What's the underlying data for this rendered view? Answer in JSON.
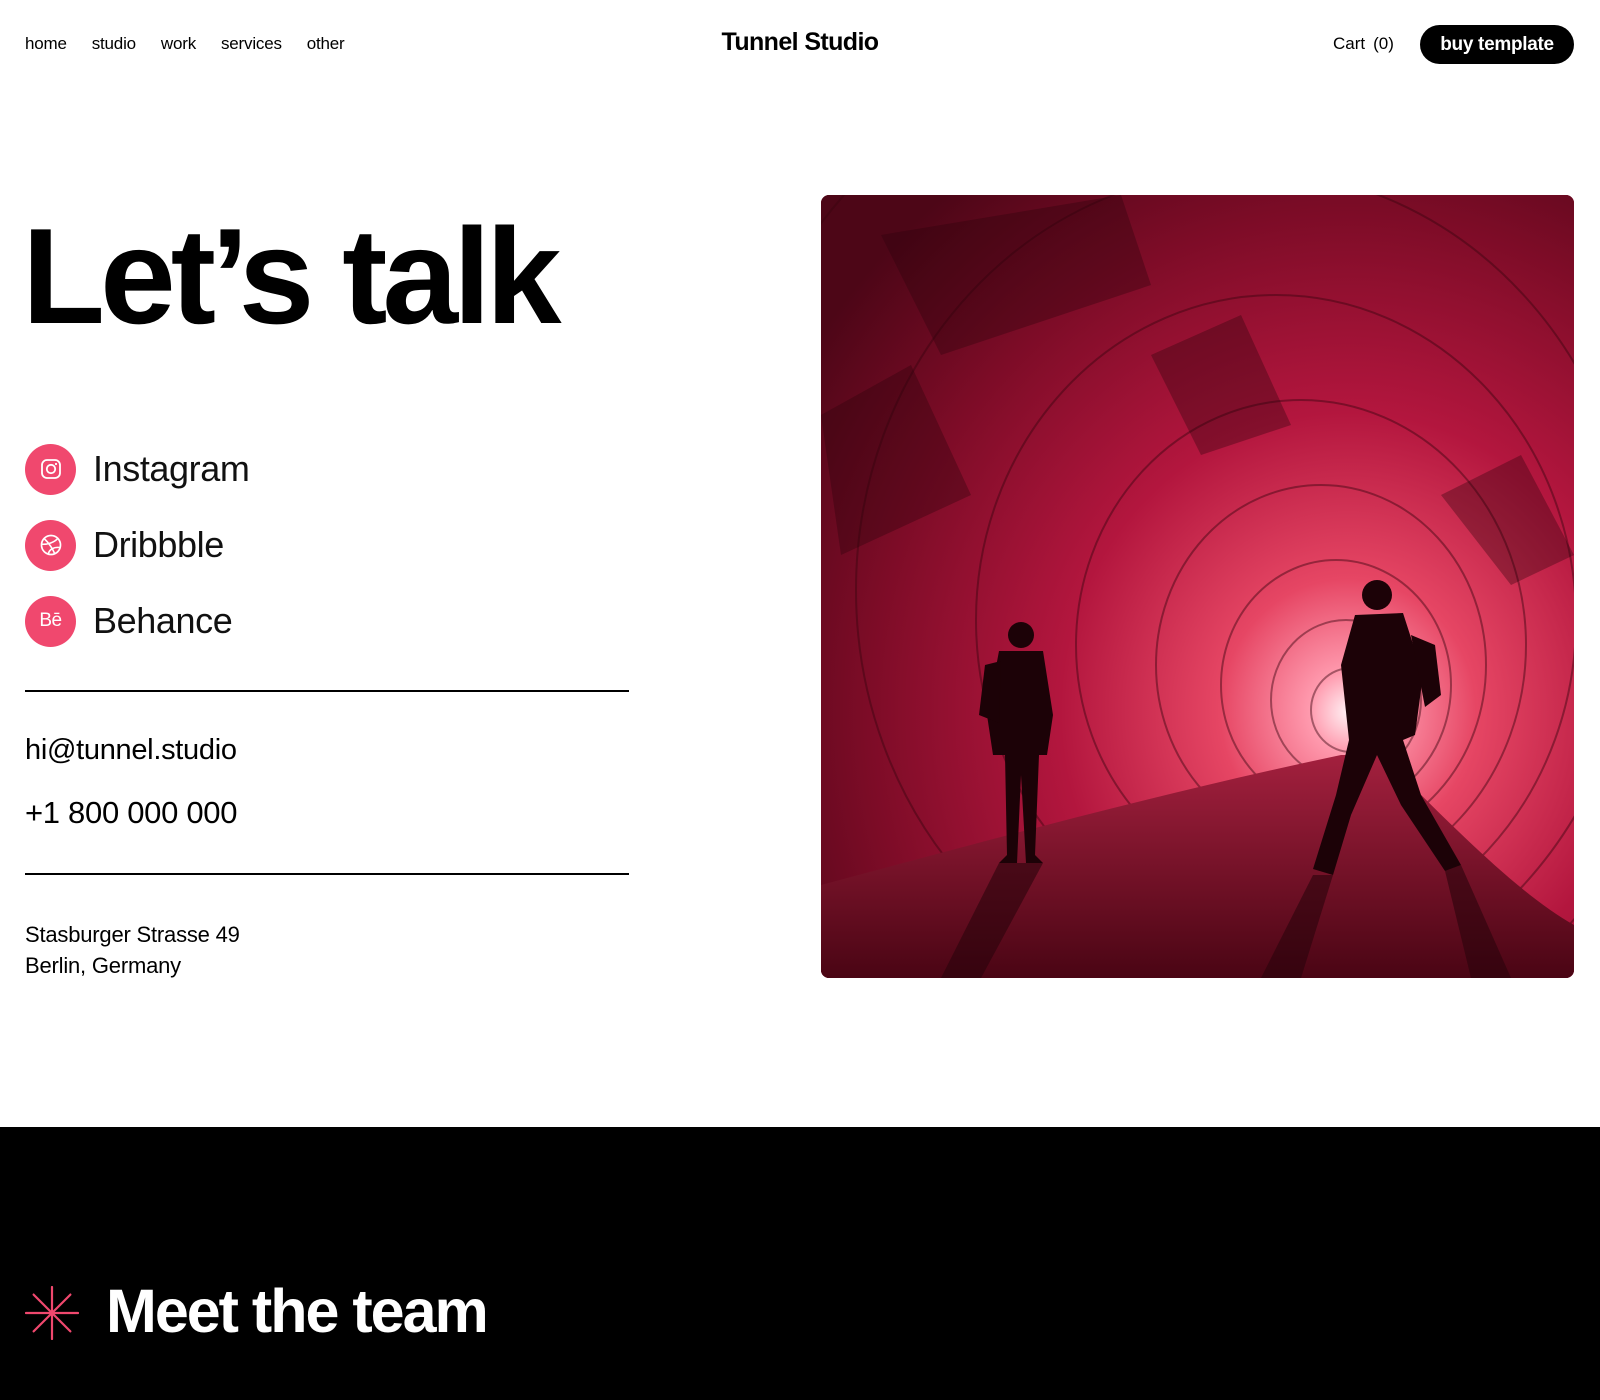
{
  "nav": {
    "items": [
      {
        "label": "home"
      },
      {
        "label": "studio"
      },
      {
        "label": "work"
      },
      {
        "label": "services"
      },
      {
        "label": "other"
      }
    ]
  },
  "header": {
    "brand": "Tunnel Studio",
    "cart_label": "Cart",
    "cart_count": "(0)",
    "buy_label": "buy template"
  },
  "contact": {
    "heading": "Let’s talk",
    "socials": [
      {
        "label": "Instagram",
        "icon": "instagram-icon"
      },
      {
        "label": "Dribbble",
        "icon": "dribbble-icon"
      },
      {
        "label": "Behance",
        "icon": "behance-icon",
        "glyph": "Bē"
      }
    ],
    "email": "hi@tunnel.studio",
    "phone": "+1 800 000 000",
    "address_line1": "Stasburger Strasse 49",
    "address_line2": "Berlin, Germany"
  },
  "photo": {
    "subject": "red-tinted tunnel with two silhouetted people"
  },
  "team": {
    "title": "Meet the team",
    "icon": "asterisk-icon"
  },
  "colors": {
    "accent": "#f0486e",
    "text": "#000000",
    "background": "#ffffff",
    "band": "#000000",
    "photo_tint": "#b3163e"
  }
}
